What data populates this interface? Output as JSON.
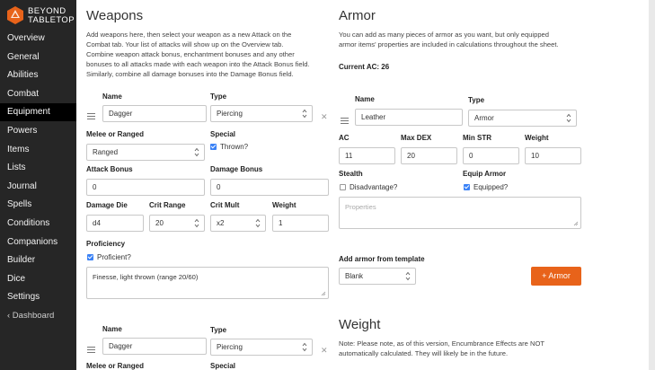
{
  "brand": {
    "line1": "BEYOND",
    "line2": "TABLETOP"
  },
  "nav": {
    "items": [
      {
        "label": "Overview"
      },
      {
        "label": "General"
      },
      {
        "label": "Abilities"
      },
      {
        "label": "Combat"
      },
      {
        "label": "Equipment",
        "active": true
      },
      {
        "label": "Powers"
      },
      {
        "label": "Items"
      },
      {
        "label": "Lists"
      },
      {
        "label": "Journal"
      },
      {
        "label": "Spells"
      },
      {
        "label": "Conditions"
      },
      {
        "label": "Companions"
      },
      {
        "label": "Builder"
      },
      {
        "label": "Dice"
      },
      {
        "label": "Settings"
      }
    ],
    "dashboard": "‹ Dashboard"
  },
  "weapons": {
    "title": "Weapons",
    "description_lines": [
      "Add weapons here, then select your weapon as a new Attack on the",
      "Combat tab. Your list of attacks will show up on the Overview tab.",
      "Combine weapon attack bonus, enchantment bonuses and any other",
      "bonuses to all attacks made with each weapon into the Attack Bonus field.",
      "Similarly, combine all damage bonuses into the Damage Bonus field."
    ],
    "labels": {
      "name": "Name",
      "type": "Type",
      "melee_or_ranged": "Melee or Ranged",
      "special": "Special",
      "attack_bonus": "Attack Bonus",
      "damage_bonus": "Damage Bonus",
      "damage_die": "Damage Die",
      "crit_range": "Crit Range",
      "crit_mult": "Crit Mult",
      "weight": "Weight",
      "proficiency": "Proficiency"
    },
    "items": [
      {
        "name": "Dagger",
        "type": "Piercing",
        "melee_or_ranged": "Ranged",
        "special_label": "Thrown?",
        "special_checked": true,
        "attack_bonus": "0",
        "damage_bonus": "0",
        "damage_die": "d4",
        "crit_range": "20",
        "crit_mult": "x2",
        "weight": "1",
        "proficient_label": "Proficient?",
        "proficient_checked": true,
        "notes": "Finesse, light thrown (range 20/60)"
      },
      {
        "name": "Dagger",
        "type": "Piercing",
        "melee_or_ranged_label": "Melee or Ranged",
        "special_label": "Special"
      }
    ]
  },
  "armor": {
    "title": "Armor",
    "description_lines": [
      "You can add as many pieces of armor as you want, but only equipped",
      "armor items' properties are included in calculations throughout the sheet."
    ],
    "current_ac": "Current AC: 26",
    "labels": {
      "name": "Name",
      "type": "Type",
      "ac": "AC",
      "max_dex": "Max DEX",
      "min_str": "Min STR",
      "weight": "Weight",
      "stealth": "Stealth",
      "equip_armor": "Equip Armor"
    },
    "item": {
      "name": "Leather",
      "type": "Armor",
      "ac": "11",
      "max_dex": "20",
      "min_str": "0",
      "weight": "10",
      "stealth_label": "Disadvantage?",
      "stealth_checked": false,
      "equipped_label": "Equipped?",
      "equipped_checked": true,
      "properties_placeholder": "Properties"
    },
    "template_label": "Add armor from template",
    "template_value": "Blank",
    "add_button": "+ Armor"
  },
  "weight": {
    "title": "Weight",
    "description_lines": [
      "Note: Please note, as of this version, Encumbrance Effects are NOT",
      "automatically calculated. They will likely be in the future."
    ]
  },
  "colors": {
    "sidebar": "#262626",
    "active": "#000000",
    "accent": "#e8631a",
    "check": "#3b82f6"
  }
}
